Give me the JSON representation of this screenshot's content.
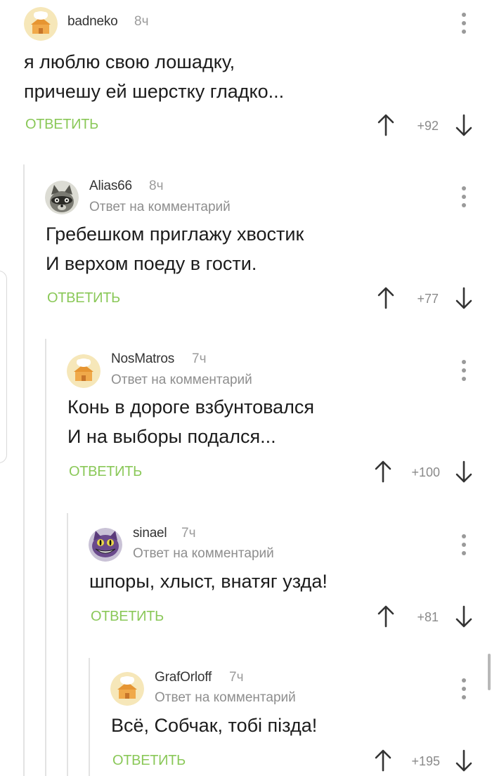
{
  "comments": [
    {
      "author": "badneko",
      "time": "8ч",
      "reply_note": "",
      "text": "я люблю свою лошадку,\nпричешу ей шерстку гладко...",
      "reply_label": "ОТВЕТИТЬ",
      "score": "+92",
      "avatar": "house-icon"
    },
    {
      "author": "Alias66",
      "time": "8ч",
      "reply_note": "Ответ на комментарий",
      "text": "Гребешком приглажу хвостик\nИ верхом поеду в гости.",
      "reply_label": "ОТВЕТИТЬ",
      "score": "+77",
      "avatar": "raccoon-icon"
    },
    {
      "author": "NosMatros",
      "time": "7ч",
      "reply_note": "Ответ на комментарий",
      "text": "Конь в дороге взбунтовался\nИ на выборы подался...",
      "reply_label": "ОТВЕТИТЬ",
      "score": "+100",
      "avatar": "house-icon"
    },
    {
      "author": "sinael",
      "time": "7ч",
      "reply_note": "Ответ на комментарий",
      "text": "шпоры, хлыст, внатяг узда!",
      "reply_label": "ОТВЕТИТЬ",
      "score": "+81",
      "avatar": "cheshire-cat-icon"
    },
    {
      "author": "GrafOrloff",
      "time": "7ч",
      "reply_note": "Ответ на комментарий",
      "text": "Всё, Собчак, тобі пізда!",
      "reply_label": "ОТВЕТИТЬ",
      "score": "+195",
      "avatar": "house-icon"
    }
  ],
  "colors": {
    "accent_green": "#8ac858",
    "meta_gray": "#9b9b9b",
    "thread_line": "#e3e3e3"
  }
}
